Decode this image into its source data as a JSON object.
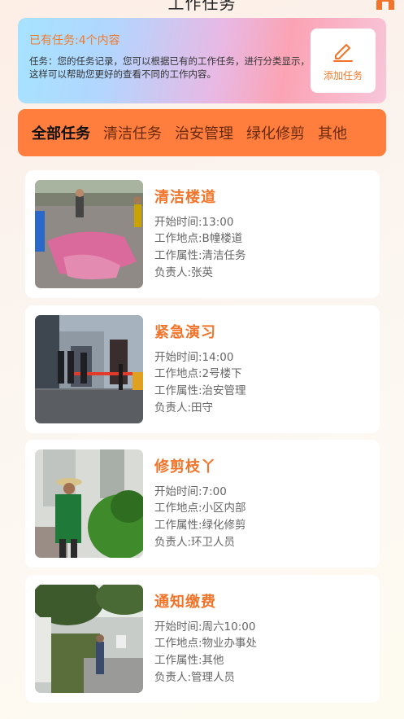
{
  "header": {
    "title": "工作任务",
    "home_icon": "home-icon"
  },
  "banner": {
    "title": "已有任务:4个内容",
    "description": "任务：您的任务记录，您可以根据已有的工作任务，进行分类显示，这样可以帮助您更好的查看不同的工作内容。",
    "add_label": "添加任务",
    "add_icon": "edit-pen-icon"
  },
  "tabs": [
    "全部任务",
    "清洁任务",
    "治安管理",
    "绿化修剪",
    "其他"
  ],
  "tasks": [
    {
      "title": "清洁楼道",
      "start": "开始时间:13:00",
      "place": "工作地点:B幢楼道",
      "type": "工作属性:清洁任务",
      "owner": "负责人:张英"
    },
    {
      "title": "紧急演习",
      "start": "开始时间:14:00",
      "place": "工作地点:2号楼下",
      "type": "工作属性:治安管理",
      "owner": "负责人:田守"
    },
    {
      "title": "修剪枝丫",
      "start": "开始时间:7:00",
      "place": "工作地点:小区内部",
      "type": "工作属性:绿化修剪",
      "owner": "负责人:环卫人员"
    },
    {
      "title": "通知缴费",
      "start": "开始时间:周六10:00",
      "place": "工作地点:物业办事处",
      "type": "工作属性:其他",
      "owner": "负责人:管理人员"
    }
  ],
  "colors": {
    "accent": "#f2742a",
    "tab_bar": "#ff7e3d"
  }
}
